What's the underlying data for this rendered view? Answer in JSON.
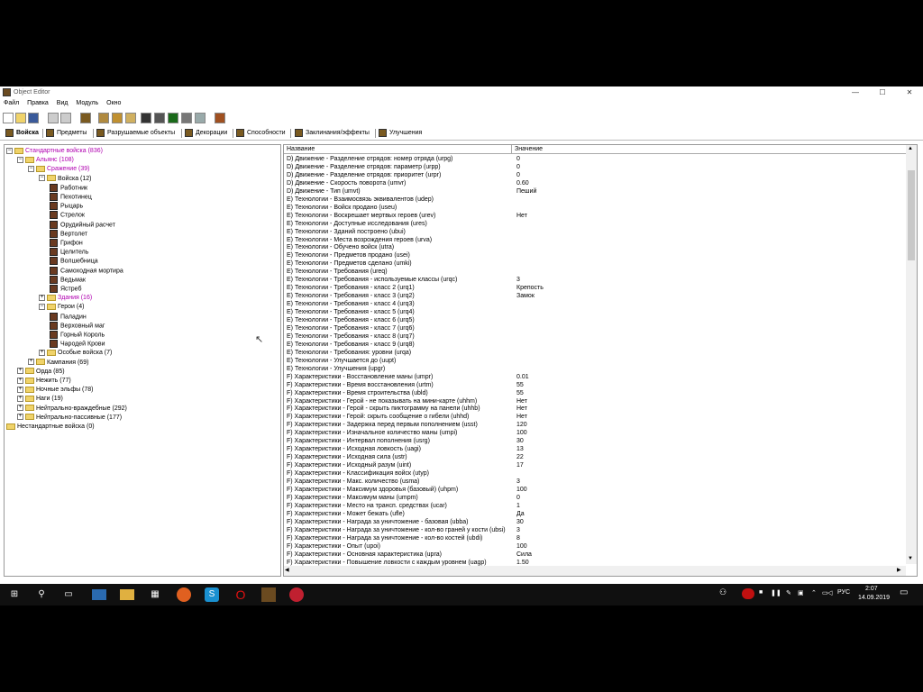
{
  "window": {
    "title": "Object Editor",
    "minimize": "—",
    "maximize": "☐",
    "close": "✕"
  },
  "menu": [
    "Файл",
    "Правка",
    "Вид",
    "Модуль",
    "Окно"
  ],
  "tabs": [
    {
      "label": "Войска"
    },
    {
      "label": "Предметы"
    },
    {
      "label": "Разрушаемые объекты"
    },
    {
      "label": "Декорации"
    },
    {
      "label": "Способности"
    },
    {
      "label": "Заклинания/эффекты"
    },
    {
      "label": "Улучшения"
    }
  ],
  "tree": [
    {
      "label": "Стандартные войска (836)",
      "indent": 0,
      "type": "folder",
      "exp": "-",
      "purple": true
    },
    {
      "label": "Альянс (108)",
      "indent": 1,
      "type": "folder",
      "exp": "-",
      "purple": true
    },
    {
      "label": "Сражение (39)",
      "indent": 2,
      "type": "folder",
      "exp": "-",
      "purple": true
    },
    {
      "label": "Войска (12)",
      "indent": 3,
      "type": "folder",
      "exp": "-"
    },
    {
      "label": "Работник",
      "indent": 4,
      "type": "unit"
    },
    {
      "label": "Пехотинец",
      "indent": 4,
      "type": "unit"
    },
    {
      "label": "Рыцарь",
      "indent": 4,
      "type": "unit"
    },
    {
      "label": "Стрелок",
      "indent": 4,
      "type": "unit"
    },
    {
      "label": "Орудийный расчет",
      "indent": 4,
      "type": "unit"
    },
    {
      "label": "Вертолет",
      "indent": 4,
      "type": "unit"
    },
    {
      "label": "Грифон",
      "indent": 4,
      "type": "unit"
    },
    {
      "label": "Целитель",
      "indent": 4,
      "type": "unit"
    },
    {
      "label": "Волшебница",
      "indent": 4,
      "type": "unit"
    },
    {
      "label": "Самоходная мортира",
      "indent": 4,
      "type": "unit"
    },
    {
      "label": "Ведьмак",
      "indent": 4,
      "type": "unit"
    },
    {
      "label": "Ястреб",
      "indent": 4,
      "type": "unit"
    },
    {
      "label": "Здания (16)",
      "indent": 3,
      "type": "folder",
      "exp": "+",
      "purple": true
    },
    {
      "label": "Герои (4)",
      "indent": 3,
      "type": "folder",
      "exp": "-"
    },
    {
      "label": "Паладин",
      "indent": 4,
      "type": "unit"
    },
    {
      "label": "Верховный маг",
      "indent": 4,
      "type": "unit"
    },
    {
      "label": "Горный Король",
      "indent": 4,
      "type": "unit"
    },
    {
      "label": "Чародей Крови",
      "indent": 4,
      "type": "unit"
    },
    {
      "label": "Особые войска (7)",
      "indent": 3,
      "type": "folder",
      "exp": "+"
    },
    {
      "label": "Кампания (69)",
      "indent": 2,
      "type": "folder",
      "exp": "+"
    },
    {
      "label": "Орда (85)",
      "indent": 1,
      "type": "folder",
      "exp": "+"
    },
    {
      "label": "Нежить (77)",
      "indent": 1,
      "type": "folder",
      "exp": "+"
    },
    {
      "label": "Ночные эльфы (78)",
      "indent": 1,
      "type": "folder",
      "exp": "+"
    },
    {
      "label": "Наги (19)",
      "indent": 1,
      "type": "folder",
      "exp": "+"
    },
    {
      "label": "Нейтрально-враждебные (292)",
      "indent": 1,
      "type": "folder",
      "exp": "+"
    },
    {
      "label": "Нейтрально-пассивные (177)",
      "indent": 1,
      "type": "folder",
      "exp": "+"
    },
    {
      "label": "Нестандартные войска (0)",
      "indent": 0,
      "type": "folder",
      "exp": ""
    }
  ],
  "list": {
    "headers": [
      "Название",
      "Значение"
    ],
    "rows": [
      [
        "D) Движение - Разделение отрядов: номер отряда (urpg)",
        "0"
      ],
      [
        "D) Движение - Разделение отрядов: параметр (urpp)",
        "0"
      ],
      [
        "D) Движение - Разделение отрядов: приоритет (urpr)",
        "0"
      ],
      [
        "D) Движение - Скорость поворота (umvr)",
        "0.60"
      ],
      [
        "D) Движение - Тип (umvt)",
        "Пеший"
      ],
      [
        "E) Технологии - Взаимосвязь эквивалентов (udep)",
        ""
      ],
      [
        "E) Технологии - Войск продано (useu)",
        ""
      ],
      [
        "E) Технологии - Воскрешает мертвых героев (urev)",
        "Нет"
      ],
      [
        "E) Технологии - Доступные исследования (ures)",
        ""
      ],
      [
        "E) Технологии - Зданий построено (ubui)",
        ""
      ],
      [
        "E) Технологии - Места возрождения героев (urva)",
        ""
      ],
      [
        "E) Технологии - Обучено войск (utra)",
        ""
      ],
      [
        "E) Технологии - Предметов продано (usei)",
        ""
      ],
      [
        "E) Технологии - Предметов сделано (umki)",
        ""
      ],
      [
        "E) Технологии - Требования (ureq)",
        ""
      ],
      [
        "E) Технологии - Требования - используемые классы (urqc)",
        "3"
      ],
      [
        "E) Технологии - Требования - класс 2 (urq1)",
        "Крепость"
      ],
      [
        "E) Технологии - Требования - класс 3 (urq2)",
        "Замок"
      ],
      [
        "E) Технологии - Требования - класс 4 (urq3)",
        ""
      ],
      [
        "E) Технологии - Требования - класс 5 (urq4)",
        ""
      ],
      [
        "E) Технологии - Требования - класс 6 (urq5)",
        ""
      ],
      [
        "E) Технологии - Требования - класс 7 (urq6)",
        ""
      ],
      [
        "E) Технологии - Требования - класс 8 (urq7)",
        ""
      ],
      [
        "E) Технологии - Требования - класс 9 (urq8)",
        ""
      ],
      [
        "E) Технологии - Требования: уровни (urqa)",
        ""
      ],
      [
        "E) Технологии - Улучшается до (uupt)",
        ""
      ],
      [
        "E) Технологии - Улучшения (upgr)",
        ""
      ],
      [
        "F) Характеристики - Восстановление маны (umpr)",
        "0.01"
      ],
      [
        "F) Характеристики - Время восстановления (urtm)",
        "55"
      ],
      [
        "F) Характеристики - Время строительства (ubld)",
        "55"
      ],
      [
        "F) Характеристики - Герой - не показывать на мини-карте (uhhm)",
        "Нет"
      ],
      [
        "F) Характеристики - Герой - скрыть пиктограмму на панели (uhhb)",
        "Нет"
      ],
      [
        "F) Характеристики - Герой: скрыть сообщение о гибели (uhhd)",
        "Нет"
      ],
      [
        "F) Характеристики - Задержка перед первым пополнением (usst)",
        "120"
      ],
      [
        "F) Характеристики - Изначальное количество маны (umpi)",
        "100"
      ],
      [
        "F) Характеристики - Интервал пополнения (usrg)",
        "30"
      ],
      [
        "F) Характеристики - Исходная ловкость (uagi)",
        "13"
      ],
      [
        "F) Характеристики - Исходная сила (ustr)",
        "22"
      ],
      [
        "F) Характеристики - Исходный разум (uint)",
        "17"
      ],
      [
        "F) Характеристики - Классификация войск (utyp)",
        ""
      ],
      [
        "F) Характеристики - Макс. количество (usma)",
        "3"
      ],
      [
        "F) Характеристики - Максимум здоровья (базовый) (uhpm)",
        "100"
      ],
      [
        "F) Характеристики - Максимум маны (umpm)",
        "0"
      ],
      [
        "F) Характеристики - Место на трансп. средствах (ucar)",
        "1"
      ],
      [
        "F) Характеристики - Может бежать (ufle)",
        "Да"
      ],
      [
        "F) Характеристики - Награда за уничтожение - базовая (ubba)",
        "30"
      ],
      [
        "F) Характеристики - Награда за уничтожение - кол-во граней у кости (ubsi)",
        "3"
      ],
      [
        "F) Характеристики - Награда за уничтожение - кол-во костей (ubdi)",
        "8"
      ],
      [
        "F) Характеристики - Опыт (upoi)",
        "100"
      ],
      [
        "F) Характеристики - Основная характеристика (upra)",
        "Сила"
      ],
      [
        "F) Характеристики - Повышение ловкости с каждым уровнем (uagp)",
        "1.50"
      ]
    ]
  },
  "taskbar": {
    "language": "РУС",
    "time": "2:07",
    "date": "14.09.2019"
  },
  "colors": {
    "accent_purple": "#b000b0",
    "taskbar": "#101010"
  }
}
